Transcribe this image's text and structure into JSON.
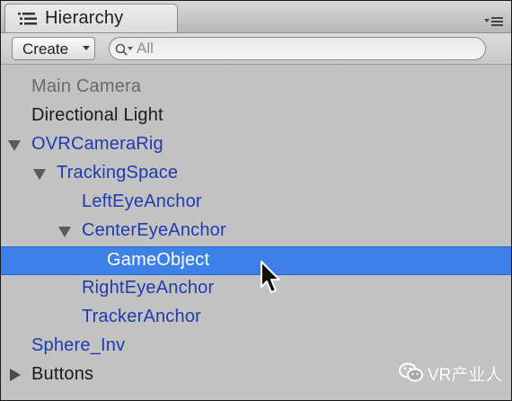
{
  "panel": {
    "title": "Hierarchy",
    "tab_icon": "hierarchy-list-icon",
    "menu_icon": "panel-menu-icon"
  },
  "toolbar": {
    "create_label": "Create",
    "search_placeholder": "All",
    "search_value": ""
  },
  "tree": [
    {
      "label": "Main Camera",
      "color": "#6a6a6a",
      "depth": 0,
      "fold": "none",
      "selected": false
    },
    {
      "label": "Directional Light",
      "color": "#1a1a1a",
      "depth": 0,
      "fold": "none",
      "selected": false
    },
    {
      "label": "OVRCameraRig",
      "color": "#1f3bb0",
      "depth": 0,
      "fold": "open",
      "selected": false
    },
    {
      "label": "TrackingSpace",
      "color": "#1f3bb0",
      "depth": 1,
      "fold": "open",
      "selected": false
    },
    {
      "label": "LeftEyeAnchor",
      "color": "#1f3bb0",
      "depth": 2,
      "fold": "none",
      "selected": false
    },
    {
      "label": "CenterEyeAnchor",
      "color": "#1f3bb0",
      "depth": 2,
      "fold": "open",
      "selected": false
    },
    {
      "label": "GameObject",
      "color": "#ffffff",
      "depth": 3,
      "fold": "none",
      "selected": true
    },
    {
      "label": "RightEyeAnchor",
      "color": "#1f3bb0",
      "depth": 2,
      "fold": "none",
      "selected": false
    },
    {
      "label": "TrackerAnchor",
      "color": "#1f3bb0",
      "depth": 2,
      "fold": "none",
      "selected": false
    },
    {
      "label": "Sphere_Inv",
      "color": "#1f3bb0",
      "depth": 0,
      "fold": "none",
      "selected": false
    },
    {
      "label": "Buttons",
      "color": "#1a1a1a",
      "depth": 0,
      "fold": "closed",
      "selected": false
    }
  ],
  "watermark": {
    "text": "VR产业人",
    "icon": "wechat-icon"
  },
  "colors": {
    "selection": "#3d81e8",
    "prefab_blue": "#1f3bb0"
  }
}
